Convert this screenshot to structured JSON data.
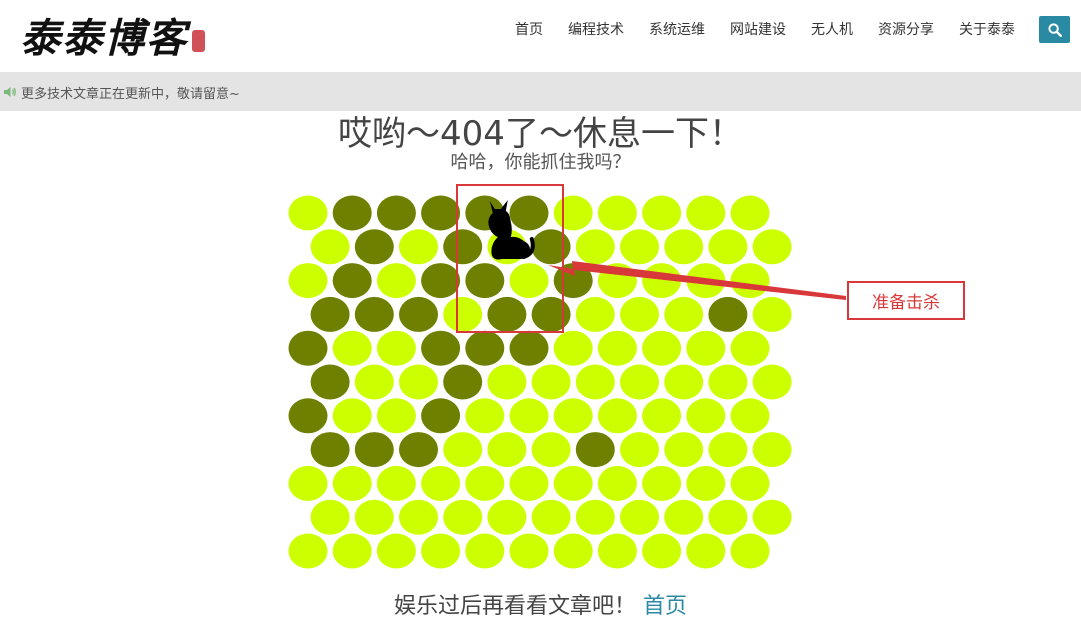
{
  "header": {
    "logo_text": "泰泰博客",
    "nav": [
      "首页",
      "编程技术",
      "系统运维",
      "网站建设",
      "无人机",
      "资源分享",
      "关于泰泰"
    ],
    "search_icon": "search-icon"
  },
  "notice": {
    "text": "更多技术文章正在更新中，敬请留意~",
    "icon": "speaker-icon"
  },
  "main": {
    "title": "哎哟～404了～休息一下！",
    "subtitle": "哈哈，你能抓住我吗？"
  },
  "game": {
    "rows": 11,
    "cols": 11,
    "colors": {
      "empty": "#ccff00",
      "blocked": "#6f7f00",
      "cat": "#000000"
    },
    "blocked": [
      [
        0,
        1
      ],
      [
        0,
        2
      ],
      [
        0,
        3
      ],
      [
        0,
        4
      ],
      [
        0,
        5
      ],
      [
        1,
        1
      ],
      [
        1,
        3
      ],
      [
        1,
        5
      ],
      [
        2,
        1
      ],
      [
        2,
        3
      ],
      [
        2,
        4
      ],
      [
        2,
        6
      ],
      [
        3,
        0
      ],
      [
        3,
        1
      ],
      [
        3,
        2
      ],
      [
        3,
        4
      ],
      [
        3,
        5
      ],
      [
        3,
        9
      ],
      [
        4,
        0
      ],
      [
        4,
        3
      ],
      [
        4,
        4
      ],
      [
        4,
        5
      ],
      [
        5,
        0
      ],
      [
        5,
        3
      ],
      [
        6,
        0
      ],
      [
        6,
        3
      ],
      [
        7,
        0
      ],
      [
        7,
        1
      ],
      [
        7,
        2
      ],
      [
        7,
        6
      ]
    ],
    "cat_position": [
      0,
      4
    ],
    "callout": "准备击杀"
  },
  "footer": {
    "text": "娱乐过后再看看文章吧！",
    "link": "首页"
  }
}
